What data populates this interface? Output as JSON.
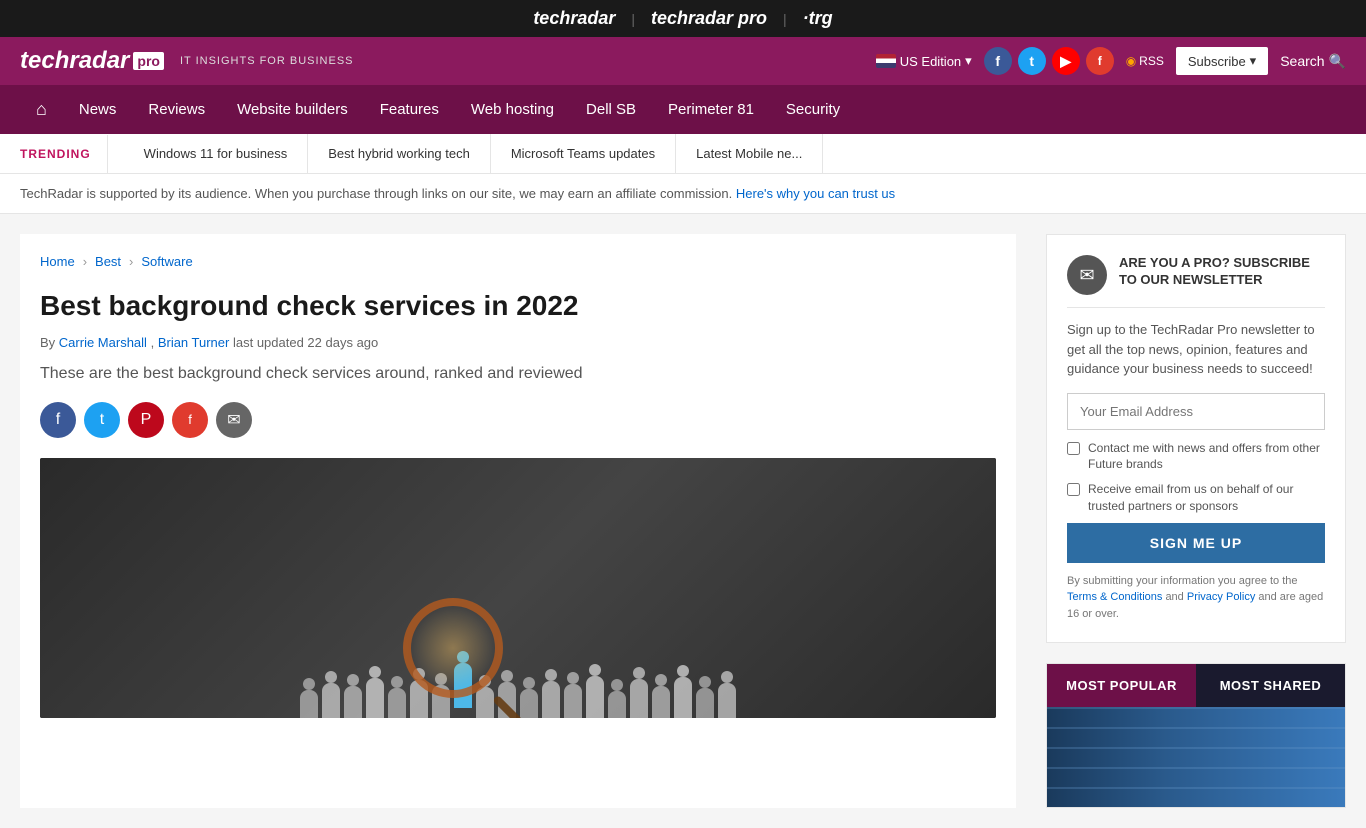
{
  "topbar": {
    "logo1": "techradar",
    "logo2": "techradar pro",
    "logo3": "·trg",
    "divider": "|"
  },
  "header": {
    "logo": "techradar",
    "logo_pro": "pro",
    "tagline": "IT INSIGHTS FOR BUSINESS",
    "edition": "US Edition",
    "rss": "RSS",
    "subscribe": "Subscribe",
    "search": "Search",
    "social": {
      "facebook": "f",
      "twitter": "t",
      "youtube": "▶",
      "flipboard": "f"
    }
  },
  "nav": {
    "home_icon": "⌂",
    "items": [
      {
        "label": "News",
        "id": "news"
      },
      {
        "label": "Reviews",
        "id": "reviews"
      },
      {
        "label": "Website builders",
        "id": "website-builders"
      },
      {
        "label": "Features",
        "id": "features"
      },
      {
        "label": "Web hosting",
        "id": "web-hosting"
      },
      {
        "label": "Dell SB",
        "id": "dell-sb"
      },
      {
        "label": "Perimeter 81",
        "id": "perimeter-81"
      },
      {
        "label": "Security",
        "id": "security"
      }
    ]
  },
  "trending": {
    "label": "TRENDING",
    "links": [
      "Windows 11 for business",
      "Best hybrid working tech",
      "Microsoft Teams updates",
      "Latest Mobile ne..."
    ]
  },
  "affiliate": {
    "text": "TechRadar is supported by its audience. When you purchase through links on our site, we may earn an affiliate commission.",
    "link_text": "Here's why you can trust us"
  },
  "breadcrumb": {
    "home": "Home",
    "best": "Best",
    "software": "Software"
  },
  "article": {
    "title": "Best background check services in 2022",
    "by_label": "By",
    "author1": "Carrie Marshall",
    "author_sep": ",",
    "author2": "Brian Turner",
    "meta": "last updated 22 days ago",
    "excerpt": "These are the best background check services around, ranked and reviewed"
  },
  "social_share": {
    "facebook": "f",
    "twitter": "t",
    "pinterest": "P",
    "flipboard": "f",
    "email": "✉"
  },
  "newsletter": {
    "icon": "✉",
    "title": "ARE YOU A PRO? SUBSCRIBE TO OUR NEWSLETTER",
    "description": "Sign up to the TechRadar Pro newsletter to get all the top news, opinion, features and guidance your business needs to succeed!",
    "email_placeholder": "Your Email Address",
    "checkbox1": "Contact me with news and offers from other Future brands",
    "checkbox2": "Receive email from us on behalf of our trusted partners or sponsors",
    "button": "SIGN ME UP",
    "terms_prefix": "By submitting your information you agree to the",
    "terms_link": "Terms & Conditions",
    "terms_and": "and",
    "privacy_link": "Privacy Policy",
    "terms_suffix": "and are aged 16 or over."
  },
  "popular": {
    "tab_popular": "MOST POPULAR",
    "tab_shared": "MOST SHARED"
  }
}
